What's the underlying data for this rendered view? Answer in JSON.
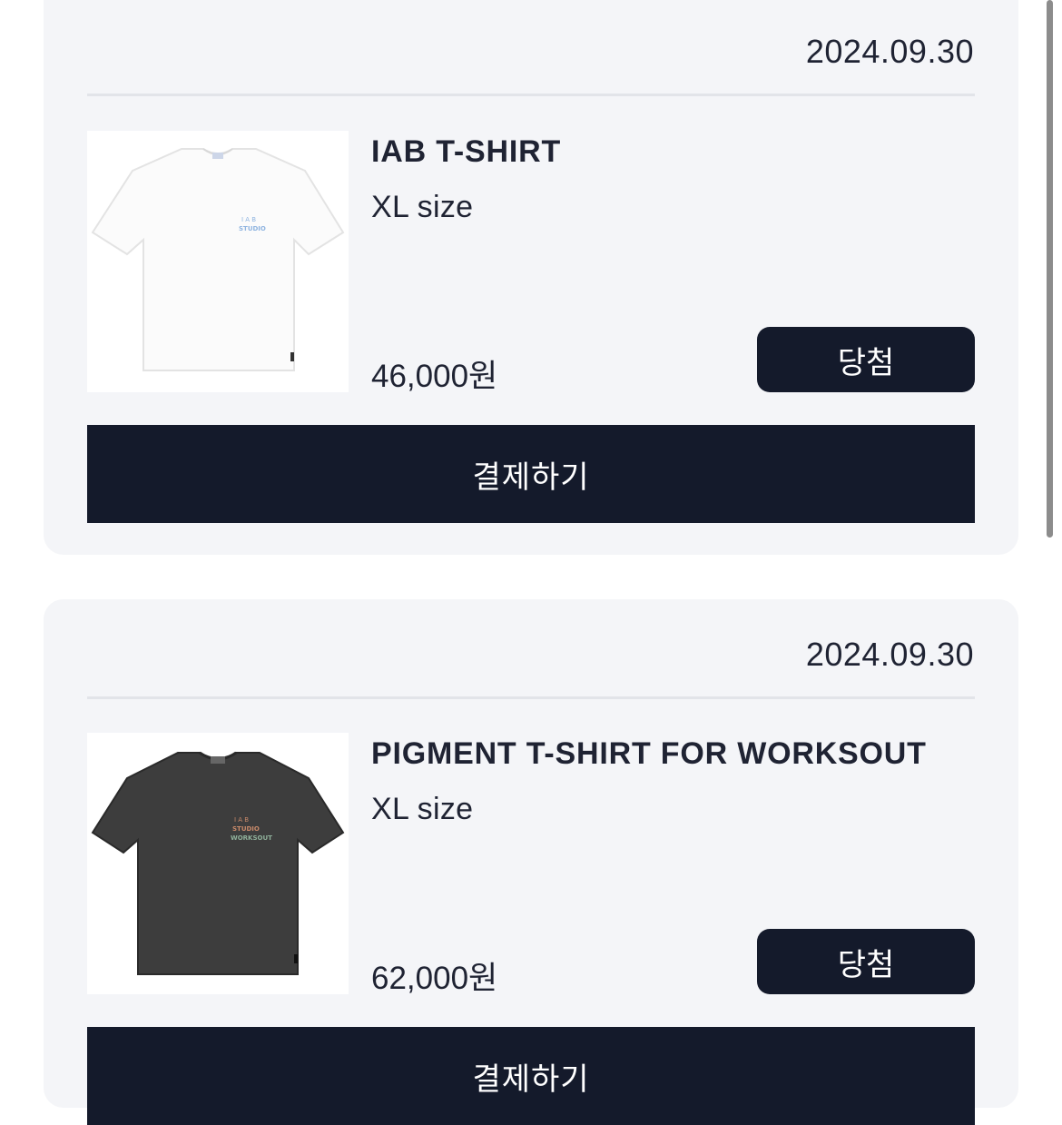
{
  "orders": [
    {
      "date": "2024.09.30",
      "product_name": "IAB T-SHIRT",
      "size": "XL size",
      "price": "46,000원",
      "status_label": "당첨",
      "pay_label": "결제하기",
      "image_icon": "white-tshirt-image",
      "print_top": "I A B",
      "print_bottom": "STUDIO"
    },
    {
      "date": "2024.09.30",
      "product_name": "PIGMENT T-SHIRT FOR WORKSOUT",
      "size": "XL size",
      "price": "62,000원",
      "status_label": "당첨",
      "pay_label": "결제하기",
      "image_icon": "charcoal-tshirt-image",
      "print_top": "I A B",
      "print_mid": "STUDIO",
      "print_bottom": "WORKSOUT"
    }
  ],
  "colors": {
    "card_bg": "#f4f5f8",
    "button_bg": "#141a2b",
    "text": "#1f2333"
  }
}
